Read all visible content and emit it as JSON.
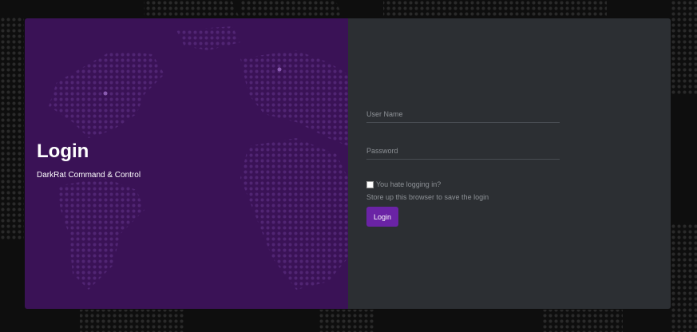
{
  "login_panel": {
    "title": "Login",
    "subtitle": "DarkRat Command & Control"
  },
  "form": {
    "username_placeholder": "User Name",
    "username_value": "",
    "password_placeholder": "Password",
    "password_value": "",
    "remember_label": "You hate logging in?",
    "remember_checked": false,
    "remember_hint": "Store up this browser to save the login",
    "submit_label": "Login"
  },
  "colors": {
    "page_background": "#0e0e0e",
    "left_panel": "#3a1256",
    "right_panel": "#2c2f33",
    "accent_button": "#6a23a5"
  }
}
